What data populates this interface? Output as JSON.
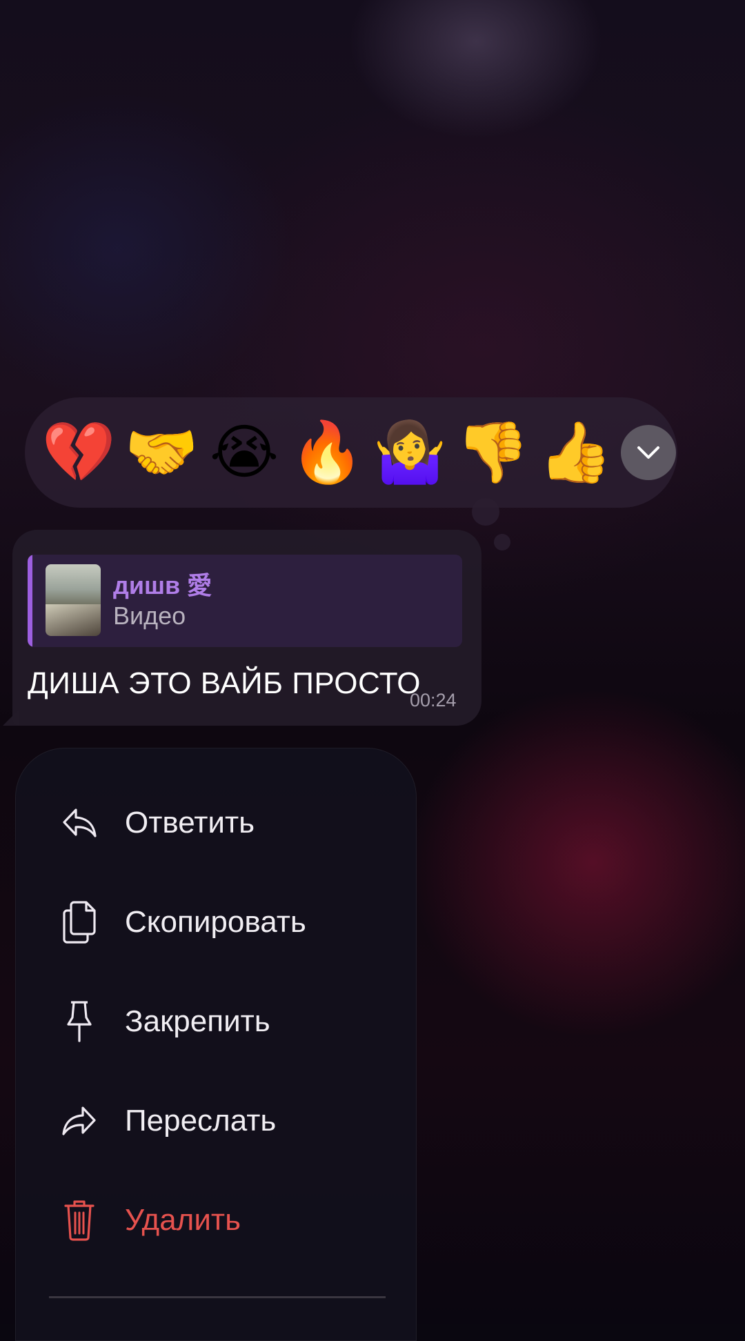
{
  "reactions": [
    {
      "emoji": "💔",
      "name": "broken-heart"
    },
    {
      "emoji": "🤝",
      "name": "handshake"
    },
    {
      "emoji": "😭",
      "name": "loudly-crying-face"
    },
    {
      "emoji": "🔥",
      "name": "fire"
    },
    {
      "emoji": "🤷‍♀️",
      "name": "woman-shrugging"
    },
    {
      "emoji": "👎",
      "name": "thumbs-down"
    },
    {
      "emoji": "👍",
      "name": "thumbs-up"
    }
  ],
  "expand_icon": "chevron-down-icon",
  "message": {
    "reply": {
      "name": "дишв 愛",
      "type": "Видео"
    },
    "text": "ДИША ЭТО ВАЙБ ПРОСТО",
    "time": "00:24"
  },
  "menu": {
    "items": [
      {
        "label": "Ответить",
        "icon": "reply-icon"
      },
      {
        "label": "Скопировать",
        "icon": "copy-icon"
      },
      {
        "label": "Закрепить",
        "icon": "pin-icon"
      },
      {
        "label": "Переслать",
        "icon": "forward-icon"
      },
      {
        "label": "Удалить",
        "icon": "trash-icon",
        "danger": true
      }
    ]
  },
  "colors": {
    "accent": "#b07ee8",
    "danger": "#e6524e"
  }
}
